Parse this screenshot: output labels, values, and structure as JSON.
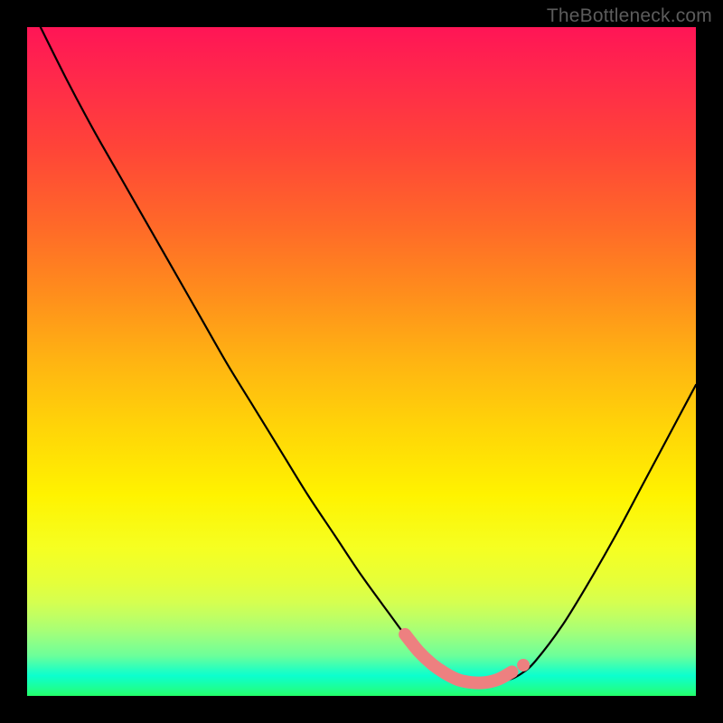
{
  "watermark": "TheBottleneck.com",
  "chart_data": {
    "type": "line",
    "title": "",
    "xlabel": "",
    "ylabel": "",
    "xlim": [
      0,
      100
    ],
    "ylim": [
      0,
      100
    ],
    "series": [
      {
        "name": "bottleneck-curve",
        "stroke": "#000000",
        "x": [
          2,
          6,
          10,
          14,
          18,
          22,
          26,
          30,
          34,
          38,
          42,
          46,
          50,
          54,
          57,
          60,
          63,
          66,
          69,
          72,
          74,
          76,
          80,
          84,
          88,
          92,
          96,
          100
        ],
        "y": [
          100,
          92,
          84.5,
          77.5,
          70.5,
          63.5,
          56.5,
          49.5,
          43,
          36.5,
          30,
          24,
          18,
          12.5,
          8.5,
          5.5,
          3.4,
          2.2,
          1.9,
          2.4,
          3.4,
          5.2,
          10.5,
          17,
          24,
          31.5,
          39,
          46.5
        ]
      }
    ],
    "annotations": [
      {
        "name": "valley-highlight",
        "type": "thick-segment",
        "stroke": "#ed8080",
        "x": [
          56.5,
          58.5,
          60.5,
          62.5,
          64.5,
          66.5,
          68.5,
          70.5,
          72.5
        ],
        "y": [
          9.2,
          6.7,
          4.8,
          3.4,
          2.4,
          2.0,
          2.0,
          2.5,
          3.6
        ]
      },
      {
        "name": "valley-end-dot",
        "type": "dot",
        "fill": "#ed8080",
        "x": 74.2,
        "y": 4.6
      }
    ]
  },
  "colors": {
    "curve": "#000000",
    "highlight": "#ed8080",
    "watermark": "#5c5c5c"
  }
}
